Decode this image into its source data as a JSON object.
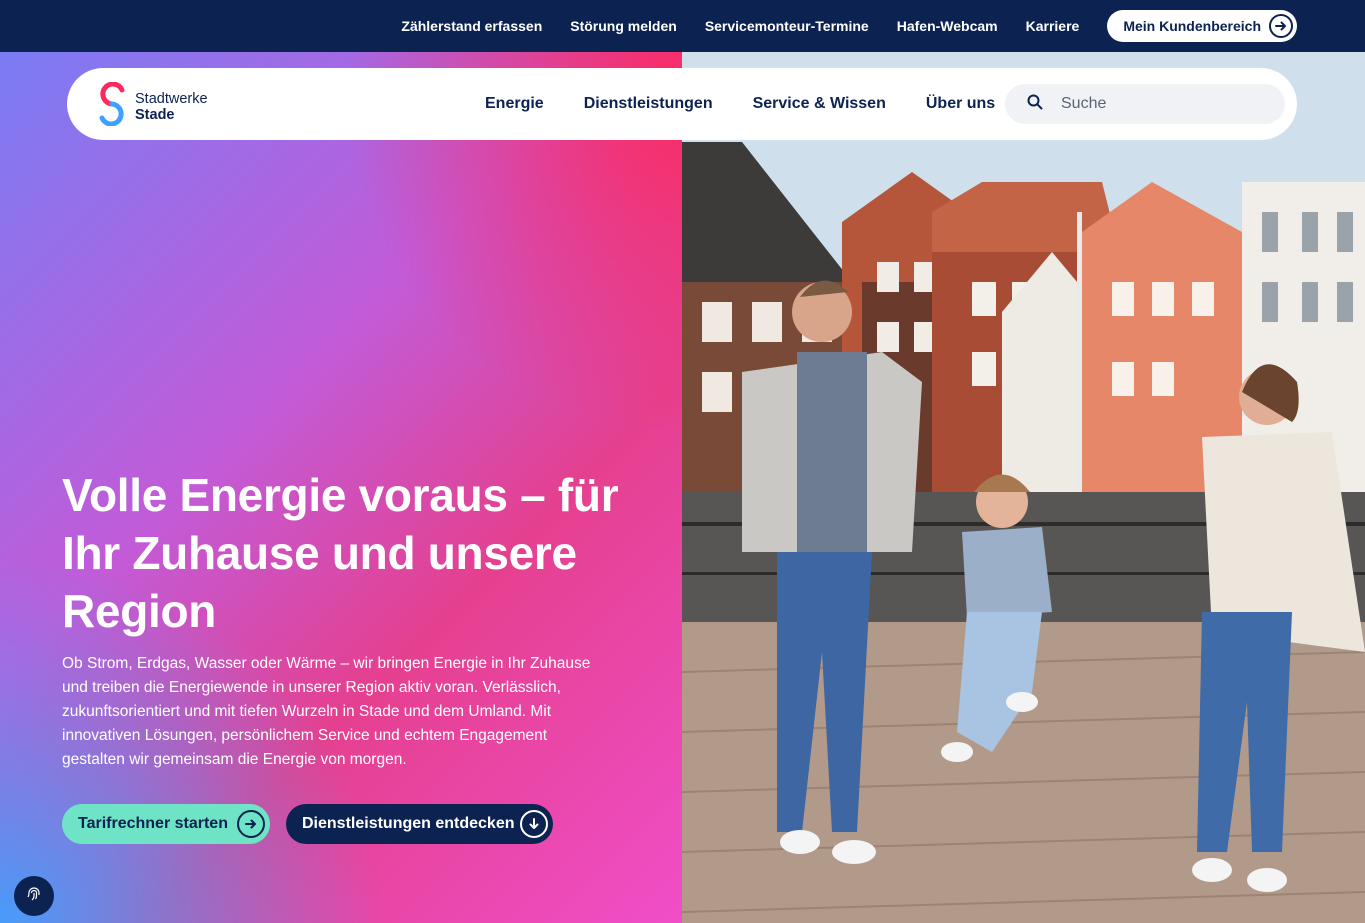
{
  "topbar": {
    "links": [
      "Zählerstand erfassen",
      "Störung melden",
      "Servicemonteur-Termine",
      "Hafen-Webcam",
      "Karriere"
    ],
    "account_label": "Mein Kundenbereich"
  },
  "brand": {
    "line1": "Stadtwerke",
    "line2": "Stade",
    "logo_icon": "stadtwerke-s-logo"
  },
  "nav": {
    "items": [
      "Energie",
      "Dienstleistungen",
      "Service & Wissen",
      "Über uns"
    ]
  },
  "search": {
    "placeholder": "Suche",
    "icon": "search-icon"
  },
  "hero": {
    "title": "Volle Energie voraus – für Ihr Zuhause und unsere Region",
    "text": "Ob Strom, Erdgas, Wasser oder Wärme – wir bringen Energie in Ihr Zuhause und treiben die Energiewende in unserer Region aktiv voran. Verlässlich, zukunftsorientiert und mit tiefen Wurzeln in Stade und dem Umland. Mit innovativen Lösungen, persönlichem Service und echtem Engagement gestalten wir gemeinsam die Energie von morgen.",
    "cta_primary": "Tarifrechner starten",
    "cta_secondary": "Dienstleistungen entdecken",
    "image_description": ""
  },
  "colors": {
    "navy": "#0c2352",
    "mint": "#6fe3c5",
    "pink": "#ff285a",
    "blue": "#40a0ff"
  },
  "cookie": {
    "icon": "fingerprint-icon"
  }
}
